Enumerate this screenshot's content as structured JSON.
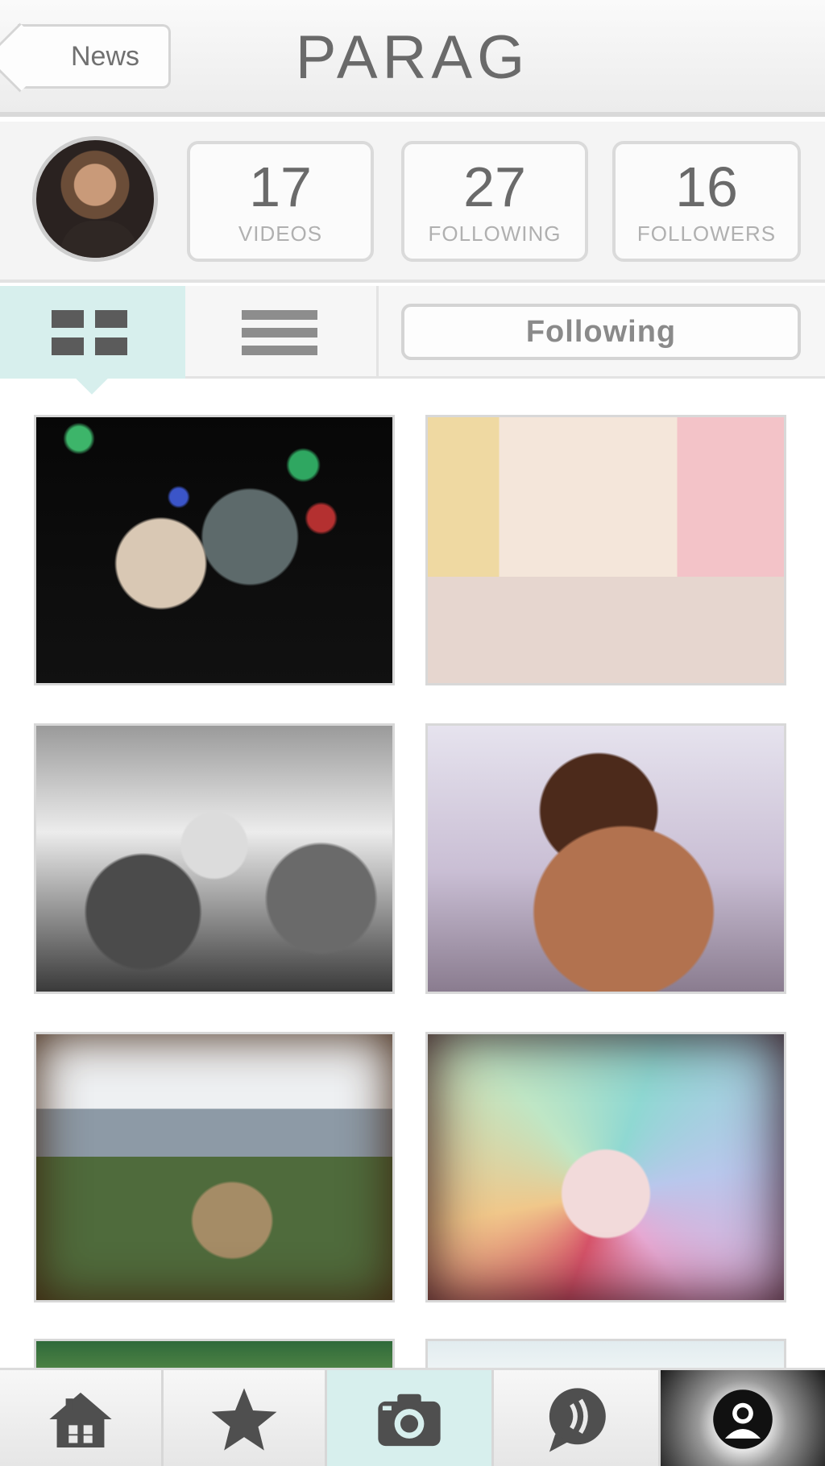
{
  "header": {
    "back_label": "News",
    "title": "PARAG"
  },
  "profile": {
    "stats": [
      {
        "count": "17",
        "label": "VIDEOS"
      },
      {
        "count": "27",
        "label": "FOLLOWING"
      },
      {
        "count": "16",
        "label": "FOLLOWERS"
      }
    ]
  },
  "toolbar": {
    "grid_view_icon": "grid-view-icon",
    "list_view_icon": "list-view-icon",
    "follow_button_label": "Following",
    "active_view": "grid"
  },
  "videos": [
    {
      "thumb": "couple-dancing"
    },
    {
      "thumb": "cat-on-floor"
    },
    {
      "thumb": "bw-group"
    },
    {
      "thumb": "woman-sunglasses"
    },
    {
      "thumb": "giraffes-city"
    },
    {
      "thumb": "balloon-canopy"
    },
    {
      "thumb": "green-partial"
    },
    {
      "thumb": "sky-partial"
    }
  ],
  "tabbar": {
    "tabs": [
      {
        "icon": "home-icon"
      },
      {
        "icon": "star-icon"
      },
      {
        "icon": "camera-icon"
      },
      {
        "icon": "activity-bubble-icon"
      },
      {
        "icon": "profile-icon"
      }
    ],
    "active_tab": "profile"
  },
  "colors": {
    "accent": "#d7efed",
    "text": "#6a6a6a"
  }
}
